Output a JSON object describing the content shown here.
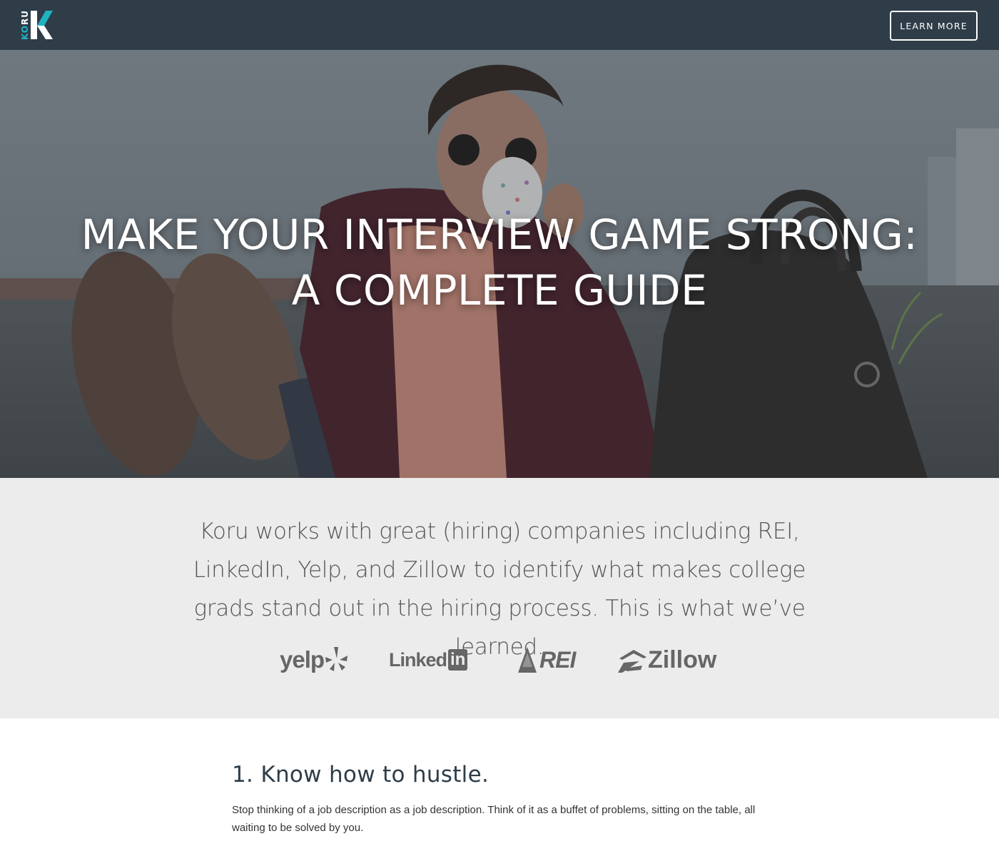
{
  "header": {
    "logo_ko": "KO",
    "logo_ru": "RU",
    "learn_more_label": "LEARN MORE"
  },
  "hero": {
    "title_line1": "MAKE YOUR INTERVIEW GAME STRONG:",
    "title_line2": "A COMPLETE GUIDE"
  },
  "partners": {
    "text": "Koru works with great (hiring) companies including REI, LinkedIn, Yelp, and Zillow to identify what makes college grads stand out in the hiring process. This is what we’ve learned.",
    "logos": {
      "yelp": "yelp",
      "linkedin_word": "Linked",
      "linkedin_box": "in",
      "rei": "REI",
      "zillow": "Zillow"
    }
  },
  "article": {
    "heading": "1. Know how to hustle.",
    "body": "Stop thinking of a job description as a job description. Think of it as a buffet of problems, sitting on the table, all waiting to be solved by you."
  },
  "colors": {
    "header_bg": "#2e3d48",
    "brand_teal": "#1fb3c2",
    "partners_bg": "#ececec",
    "logo_grey": "#666666"
  },
  "icons": [
    "koru-logo-icon",
    "yelp-burst-icon",
    "rei-mountain-icon",
    "zillow-house-icon"
  ]
}
